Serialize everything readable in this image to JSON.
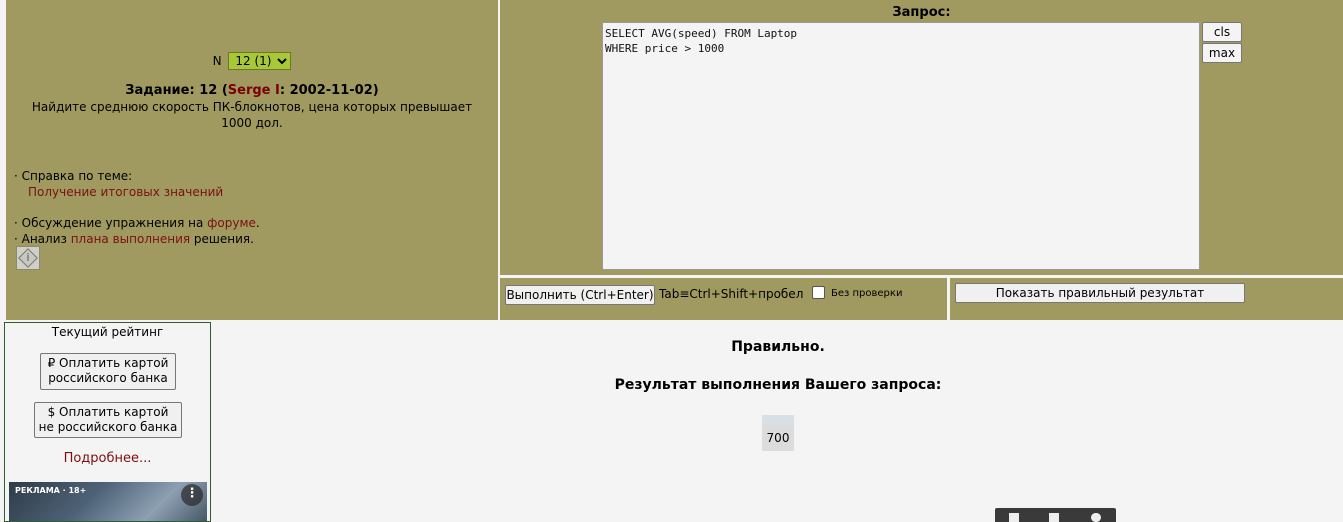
{
  "task": {
    "num_label": "N",
    "num_selected": "12 (1)",
    "title_prefix": "Задание: 12 (",
    "author": "Serge I",
    "title_suffix": ": 2002-11-02)",
    "text": "Найдите среднюю скорость ПК-блокнотов, цена которых превышает 1000 дол.",
    "help_label": "· Справка по теме:",
    "help_link": "Получение итоговых значений",
    "forum_prefix": "· Обсуждение упражнения на ",
    "forum_link": "форуме",
    "forum_suffix": ".",
    "plan_prefix": "· Анализ ",
    "plan_link": "плана выполнения",
    "plan_suffix": " решения.",
    "info_icon": "i"
  },
  "query": {
    "title": "Запрос:",
    "sql": "SELECT AVG(speed) FROM Laptop\nWHERE price > 1000",
    "cls_label": "cls",
    "max_label": "max"
  },
  "controls": {
    "run_label": "Выполнить (Ctrl+Enter)",
    "tab_hint": "Tab≡Ctrl+Shift+пробел",
    "no_check_label": "Без проверки",
    "show_label": "Показать правильный результат"
  },
  "sidebar": {
    "rating": "Текущий рейтинг",
    "pay_ru_line1": "₽ Оплатить картой",
    "pay_ru_line2": "российского банка",
    "pay_foreign_line1": "$ Оплатить картой",
    "pay_foreign_line2": "не российского банка",
    "more": "Подробнее...",
    "ad_label": "РЕКЛАМА · 18+",
    "ad_menu": "⋮"
  },
  "result": {
    "status": "Правильно.",
    "title": "Результат выполнения Вашего запроса:",
    "value": "700"
  }
}
